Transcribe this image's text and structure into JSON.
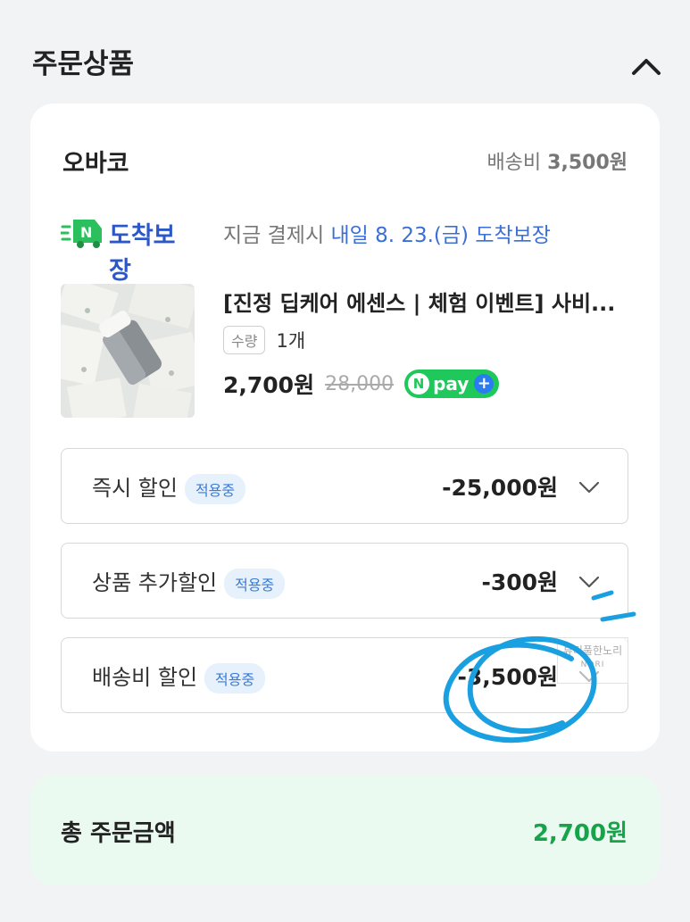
{
  "header": {
    "title": "주문상품"
  },
  "order": {
    "seller": "오바코",
    "shipping_label": "배송비",
    "shipping_fee": "3,500원",
    "delivery_badge": "도착보장",
    "delivery_prefix": "지금 결제시",
    "delivery_date": "내일 8. 23.(금) 도착보장",
    "product": {
      "title": "[진정 딥케어 에센스 | 체험 이벤트] 사비...",
      "qty_label": "수량",
      "qty_value": "1개",
      "price": "2,700원",
      "original_price": "28,000",
      "npay_text": "pay",
      "npay_n": "N",
      "npay_plus": "+"
    },
    "discounts": [
      {
        "label": "즉시 할인",
        "tag": "적용중",
        "amount": "-25,000원"
      },
      {
        "label": "상품 추가할인",
        "tag": "적용중",
        "amount": "-300원"
      },
      {
        "label": "배송비 할인",
        "tag": "적용중",
        "amount": "-3,500원"
      }
    ]
  },
  "total": {
    "label": "총 주문금액",
    "amount": "2,700원"
  },
  "watermark": {
    "line1": "뷰티풀한노리",
    "line2": "NORI"
  },
  "colors": {
    "accent_blue": "#3b6fd6",
    "total_green": "#16a34a",
    "npay_green": "#1fc85a",
    "scribble_blue": "#1aa0e0"
  },
  "icons": {
    "collapse": "chevron-up-icon",
    "expand": "chevron-down-icon",
    "delivery": "delivery-truck-icon"
  }
}
